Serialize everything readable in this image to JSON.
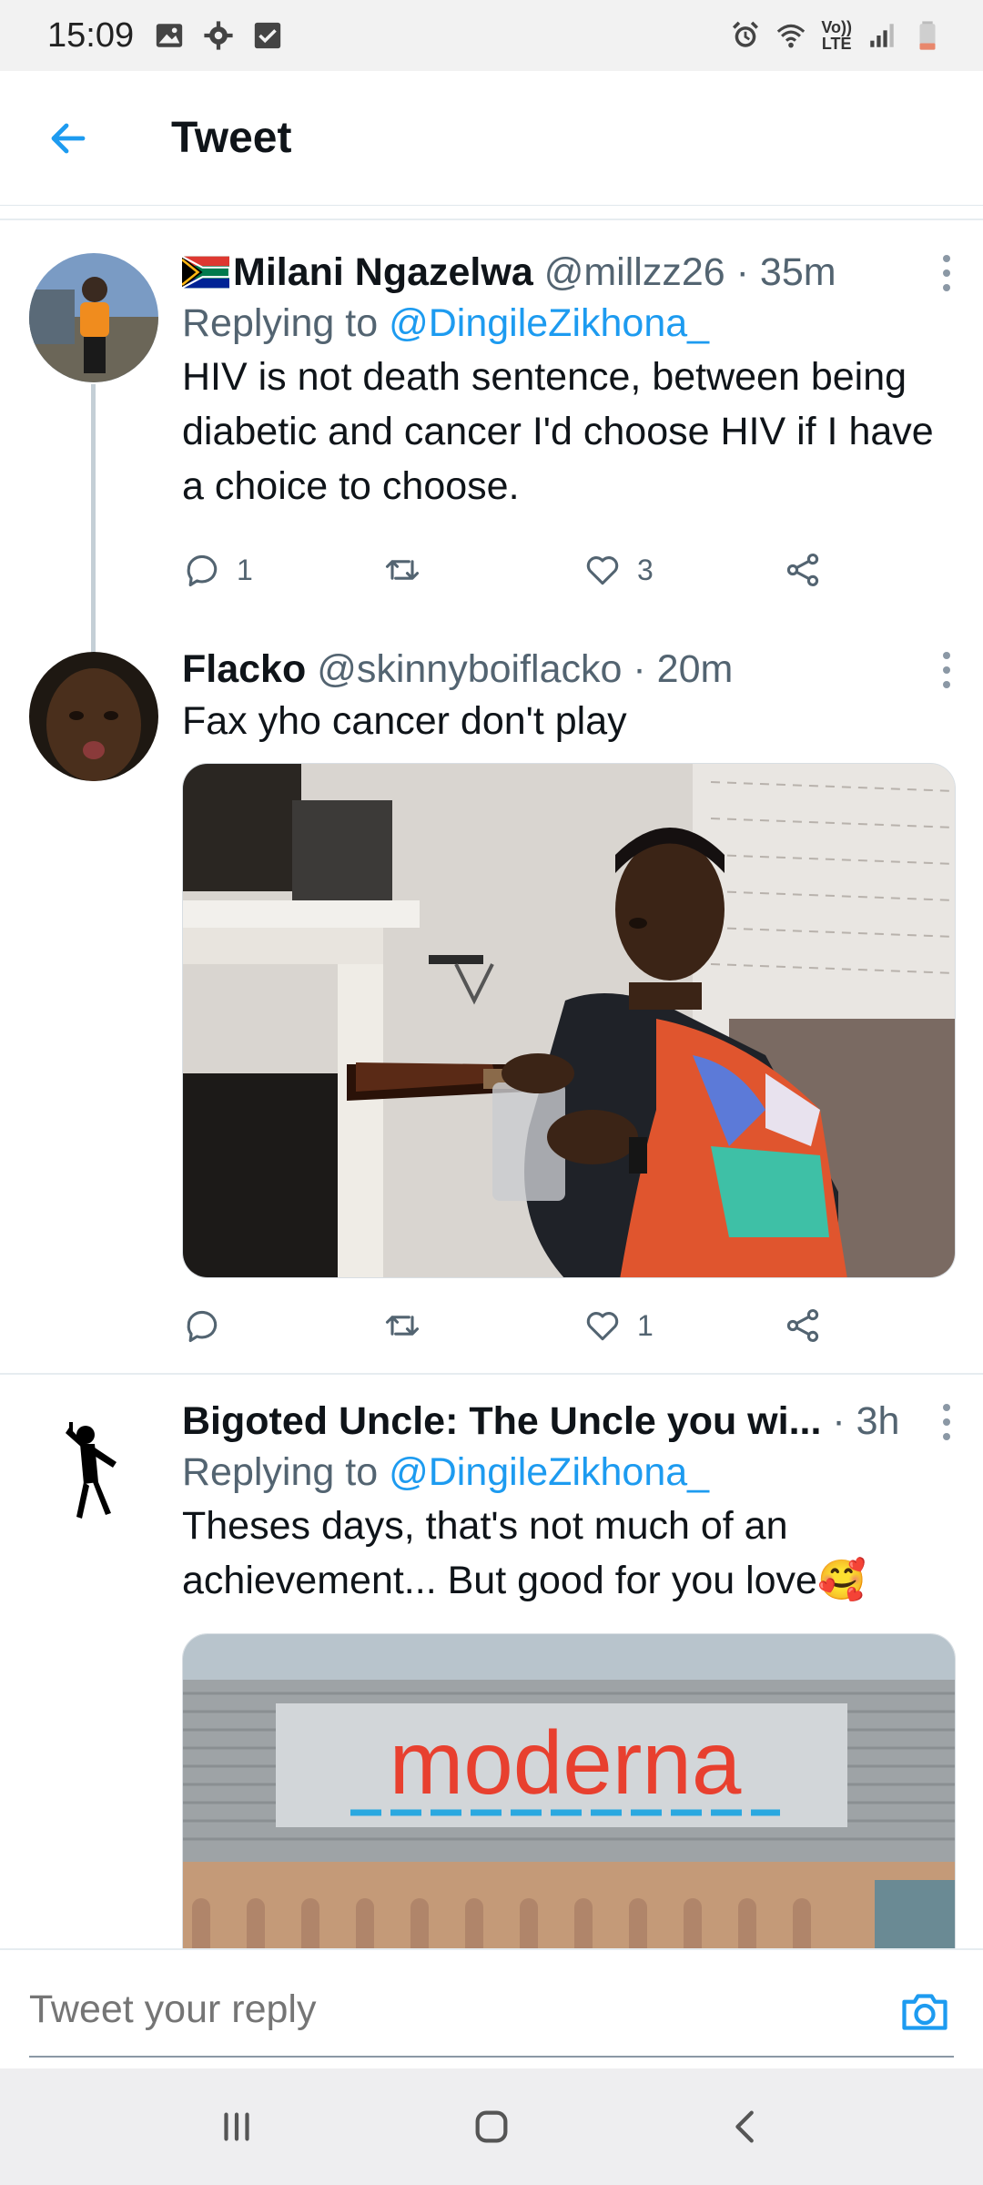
{
  "status_bar": {
    "time": "15:09",
    "network_label_top": "Vo))",
    "network_label_bottom": "LTE"
  },
  "header": {
    "title": "Tweet"
  },
  "tweets": [
    {
      "name": "Milani Ngazelwa",
      "handle": "@millzz26",
      "separator": "·",
      "time": "35m",
      "replying_prefix": "Replying to ",
      "replying_to": "@DingileZikhona_",
      "text": "HIV is not death sentence, between being diabetic and cancer I'd choose HIV if I have a choice to choose.",
      "reply_count": "1",
      "retweet_count": "",
      "like_count": "3"
    },
    {
      "name": "Flacko",
      "handle": "@skinnyboiflacko",
      "separator": "·",
      "time": "20m",
      "text": "Fax yho cancer don't play",
      "reply_count": "",
      "retweet_count": "",
      "like_count": "1"
    },
    {
      "name": "Bigoted Uncle: The Uncle you wi...",
      "handle": "",
      "separator": "·",
      "time": "3h",
      "replying_prefix": "Replying to ",
      "replying_to": "@DingileZikhona_",
      "text": "Theses days, that's not much of an achievement... But good for you love🥰",
      "media_sign_text": "moderna"
    }
  ],
  "reply_bar": {
    "placeholder": "Tweet your reply"
  },
  "colors": {
    "accent": "#1d9bf0",
    "secondary_text": "#536471",
    "divider": "#e6ecf0",
    "moderna_red": "#e8402f"
  },
  "icons": {
    "back": "arrow-left-icon",
    "more": "more-vertical-icon",
    "reply": "comment-icon",
    "retweet": "retweet-icon",
    "like": "heart-icon",
    "share": "share-icon",
    "camera": "camera-icon"
  }
}
